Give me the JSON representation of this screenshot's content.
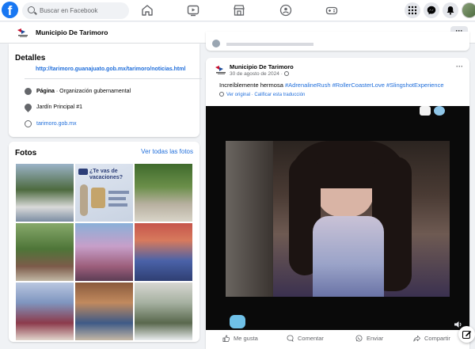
{
  "topbar": {
    "logo_letter": "f",
    "search_placeholder": "Buscar en Facebook",
    "nav_icons": [
      "home-icon",
      "video-icon",
      "marketplace-icon",
      "groups-icon",
      "gaming-icon"
    ],
    "right_icons": [
      "menu-grid-icon",
      "messenger-icon",
      "bell-icon"
    ]
  },
  "pagebar": {
    "page_name": "Municipio De Tarimoro",
    "more_label": "···"
  },
  "details": {
    "title": "Detalles",
    "link": "http://tarimoro.guanajuato.gob.mx/tarimoro/noticias.html",
    "rows": [
      {
        "icon": "info-icon",
        "bold": "Página",
        "text": " · Organización gubernamental"
      },
      {
        "icon": "location-icon",
        "bold": "",
        "text": "Jardín Principal #1"
      },
      {
        "icon": "globe-icon",
        "bold": "",
        "text": "tarimoro.gob.mx"
      }
    ]
  },
  "photos": {
    "title": "Fotos",
    "see_all": "Ver todas las fotos",
    "tile_text": "¿Te vas de vacaciones?",
    "colors": [
      "#3b5d7a",
      "#d6dbe3",
      "#4e6f3a",
      "#6f8b4a",
      "#b79bc8",
      "#8b4b6a",
      "#5a7fbf",
      "#a36b4c",
      "#7f8f8a"
    ]
  },
  "post": {
    "author": "Municipio De Tarimoro",
    "date": "30 de agosto de 2024 · ",
    "text_plain": "Increíblemente hermosa ",
    "hashtags": "#AdrenalineRush #RollerCoasterLove #SlingshotExperience",
    "translation": "Ver original · Calificar esta traducción",
    "more_label": "···",
    "actions": [
      {
        "icon": "like-icon",
        "label": "Me gusta"
      },
      {
        "icon": "comment-icon",
        "label": "Comentar"
      },
      {
        "icon": "whatsapp-icon",
        "label": "Enviar"
      },
      {
        "icon": "share-icon",
        "label": "Compartir"
      }
    ]
  },
  "colors": {
    "accent": "#1877f2",
    "link": "#216fdb",
    "muted": "#65676b",
    "background": "#f0f2f5"
  }
}
